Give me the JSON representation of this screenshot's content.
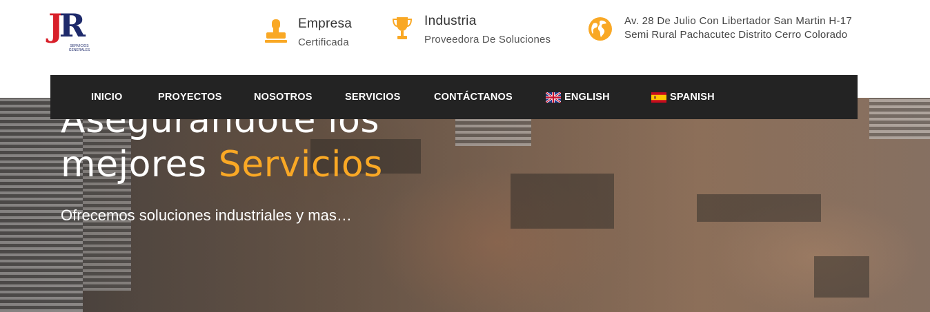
{
  "brand": {
    "logo_text_j": "J",
    "logo_text_r": "R",
    "logo_sub": "SERVICIOS GENERALES"
  },
  "header_info": [
    {
      "icon": "stamp-icon",
      "title": "Empresa",
      "subtitle": "Certificada"
    },
    {
      "icon": "trophy-icon",
      "title": "Industria",
      "subtitle": "Proveedora De Soluciones"
    },
    {
      "icon": "globe-icon",
      "title": "Av. 28 De Julio Con Libertador San Martin H-17",
      "subtitle": "Semi Rural Pachacutec Distrito Cerro Colorado"
    }
  ],
  "nav": {
    "items": [
      "INICIO",
      "PROYECTOS",
      "NOSOTROS",
      "SERVICIOS",
      "CONTÁCTANOS"
    ],
    "languages": [
      {
        "flag": "uk-flag-icon",
        "label": "ENGLISH"
      },
      {
        "flag": "spain-flag-icon",
        "label": "SPANISH"
      }
    ]
  },
  "hero": {
    "title_line1": "Asegurandote los",
    "title_line2_plain": "mejores ",
    "title_line2_accent": "Servicios",
    "subtitle": "Ofrecemos soluciones industriales y mas…"
  },
  "colors": {
    "accent": "#f9a825",
    "nav_bg": "#232323",
    "icon": "#f9a825"
  }
}
